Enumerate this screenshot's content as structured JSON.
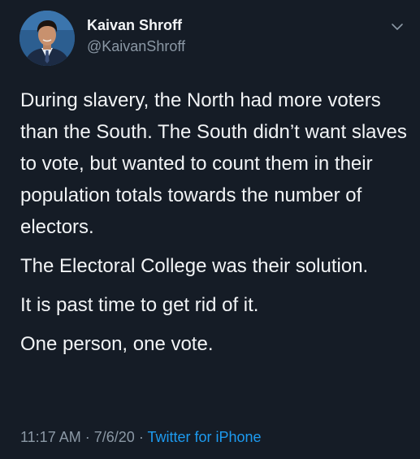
{
  "user": {
    "name": "Kaivan Shroff",
    "handle": "@KaivanShroff"
  },
  "tweet": {
    "paragraphs": [
      "During slavery, the North had more voters than the South. The South didn’t want slaves to vote, but wanted to count them in their population totals towards the number of electors.",
      "The Electoral College was their solution.",
      "It is past time to get rid of it.",
      "One person, one vote."
    ],
    "time": "11:17 AM",
    "date": "7/6/20",
    "separator": "·",
    "source": "Twitter for iPhone"
  },
  "icons": {
    "menu": "chevron-down-icon",
    "avatar": "avatar"
  },
  "colors": {
    "background": "#151c26",
    "text": "#f2f4f6",
    "secondary": "#8b98a5",
    "link": "#1d9bf0"
  }
}
